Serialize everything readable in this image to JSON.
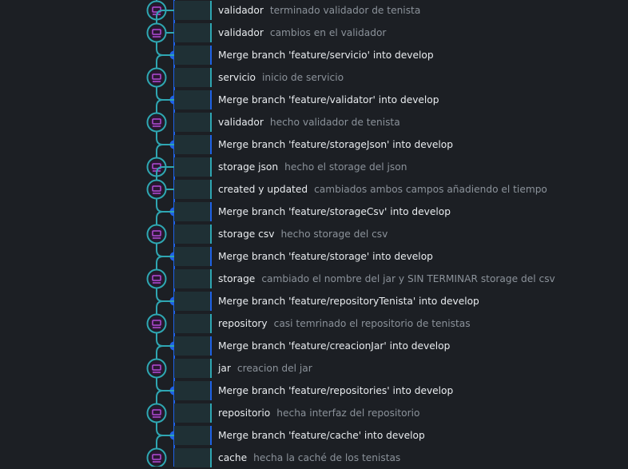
{
  "theme": {
    "branch_color": "#2fa6b2",
    "develop_color": "#1f62e6",
    "avatar_color": "#b24bd6"
  },
  "commits": [
    {
      "type": "commit",
      "title": "validador",
      "desc": "terminado validador de tenista",
      "avatar": "user-avatar"
    },
    {
      "type": "commit",
      "title": "validador",
      "desc": "cambios en el validador",
      "avatar": "user-avatar"
    },
    {
      "type": "merge",
      "title": "Merge branch 'feature/servicio' into develop",
      "desc": ""
    },
    {
      "type": "commit",
      "title": "servicio",
      "desc": "inicio de servicio",
      "avatar": "user-avatar"
    },
    {
      "type": "merge",
      "title": "Merge branch 'feature/validator' into develop",
      "desc": ""
    },
    {
      "type": "commit",
      "title": "validador",
      "desc": "hecho validador de tenista",
      "avatar": "user-avatar"
    },
    {
      "type": "merge",
      "title": "Merge branch 'feature/storageJson' into develop",
      "desc": ""
    },
    {
      "type": "commit",
      "title": "storage json",
      "desc": "hecho el storage del json",
      "avatar": "user-avatar"
    },
    {
      "type": "commit",
      "title": "created y updated",
      "desc": "cambiados ambos campos añadiendo el tiempo",
      "avatar": "user-avatar"
    },
    {
      "type": "merge",
      "title": "Merge branch 'feature/storageCsv' into develop",
      "desc": ""
    },
    {
      "type": "commit",
      "title": "storage csv",
      "desc": "hecho storage del csv",
      "avatar": "user-avatar"
    },
    {
      "type": "merge",
      "title": "Merge branch 'feature/storage' into develop",
      "desc": ""
    },
    {
      "type": "commit",
      "title": "storage",
      "desc": "cambiado el nombre del jar y SIN TERMINAR storage del csv",
      "avatar": "user-avatar"
    },
    {
      "type": "merge",
      "title": "Merge branch 'feature/repositoryTenista' into develop",
      "desc": ""
    },
    {
      "type": "commit",
      "title": "repository",
      "desc": "casi temrinado el repositorio de tenistas",
      "avatar": "user-avatar"
    },
    {
      "type": "merge",
      "title": "Merge branch 'feature/creacionJar' into develop",
      "desc": ""
    },
    {
      "type": "commit",
      "title": "jar",
      "desc": "creacion del jar",
      "avatar": "user-avatar"
    },
    {
      "type": "merge",
      "title": "Merge branch 'feature/repositories' into develop",
      "desc": ""
    },
    {
      "type": "commit",
      "title": "repositorio",
      "desc": "hecha interfaz del repositorio",
      "avatar": "user-avatar"
    },
    {
      "type": "merge",
      "title": "Merge branch 'feature/cache' into develop",
      "desc": ""
    },
    {
      "type": "commit",
      "title": "cache",
      "desc": "hecha la caché de los tenistas",
      "avatar": "user-avatar"
    }
  ]
}
